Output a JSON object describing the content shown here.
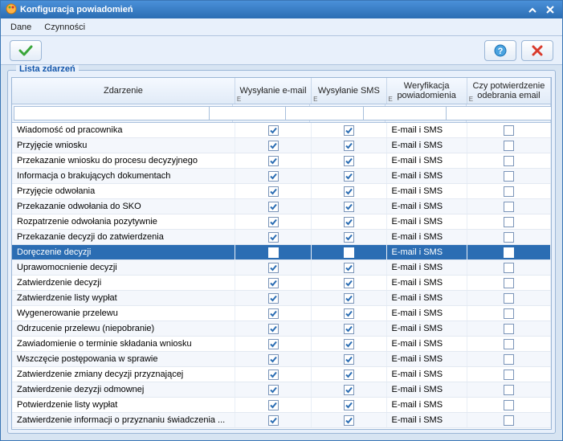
{
  "window": {
    "title": "Konfiguracja powiadomień"
  },
  "menu": {
    "dane": "Dane",
    "czynnosci": "Czynności"
  },
  "fieldset": {
    "legend": "Lista zdarzeń"
  },
  "columns": {
    "event": "Zdarzenie",
    "email": "Wysyłanie e-mail",
    "sms": "Wysyłanie SMS",
    "verif": "Weryfikacja powiadomienia",
    "confirm": "Czy potwierdzenie odebrania email",
    "sub": "E"
  },
  "rows": [
    {
      "event": "Wiadomość od pracownika",
      "email": true,
      "sms": true,
      "verif": "E-mail i SMS",
      "confirm": false
    },
    {
      "event": "Przyjęcie wniosku",
      "email": true,
      "sms": true,
      "verif": "E-mail i SMS",
      "confirm": false
    },
    {
      "event": "Przekazanie wniosku do procesu decyzyjnego",
      "email": true,
      "sms": true,
      "verif": "E-mail i SMS",
      "confirm": false
    },
    {
      "event": "Informacja o brakujących dokumentach",
      "email": true,
      "sms": true,
      "verif": "E-mail i SMS",
      "confirm": false
    },
    {
      "event": "Przyjęcie odwołania",
      "email": true,
      "sms": true,
      "verif": "E-mail i SMS",
      "confirm": false
    },
    {
      "event": "Przekazanie odwołania do SKO",
      "email": true,
      "sms": true,
      "verif": "E-mail i SMS",
      "confirm": false
    },
    {
      "event": "Rozpatrzenie odwołania pozytywnie",
      "email": true,
      "sms": true,
      "verif": "E-mail i SMS",
      "confirm": false
    },
    {
      "event": "Przekazanie decyzji do zatwierdzenia",
      "email": true,
      "sms": true,
      "verif": "E-mail i SMS",
      "confirm": false
    },
    {
      "event": "Doręczenie decyzji",
      "email": true,
      "sms": true,
      "verif": "E-mail i SMS",
      "confirm": false,
      "selected": true
    },
    {
      "event": "Uprawomocnienie decyzji",
      "email": true,
      "sms": true,
      "verif": "E-mail i SMS",
      "confirm": false
    },
    {
      "event": "Zatwierdzenie decyzji",
      "email": true,
      "sms": true,
      "verif": "E-mail i SMS",
      "confirm": false
    },
    {
      "event": "Zatwierdzenie listy wypłat",
      "email": true,
      "sms": true,
      "verif": "E-mail i SMS",
      "confirm": false
    },
    {
      "event": "Wygenerowanie przelewu",
      "email": true,
      "sms": true,
      "verif": "E-mail i SMS",
      "confirm": false
    },
    {
      "event": "Odrzucenie przelewu (niepobranie)",
      "email": true,
      "sms": true,
      "verif": "E-mail i SMS",
      "confirm": false
    },
    {
      "event": "Zawiadomienie o terminie składania wniosku",
      "email": true,
      "sms": true,
      "verif": "E-mail i SMS",
      "confirm": false
    },
    {
      "event": "Wszczęcie postępowania w sprawie",
      "email": true,
      "sms": true,
      "verif": "E-mail i SMS",
      "confirm": false
    },
    {
      "event": "Zatwierdzenie zmiany decyzji przyznającej",
      "email": true,
      "sms": true,
      "verif": "E-mail i SMS",
      "confirm": false
    },
    {
      "event": "Zatwierdzenie dezyzji odmownej",
      "email": true,
      "sms": true,
      "verif": "E-mail i SMS",
      "confirm": false
    },
    {
      "event": "Potwierdzenie listy wypłat",
      "email": true,
      "sms": true,
      "verif": "E-mail i SMS",
      "confirm": false
    },
    {
      "event": "Zatwierdzenie informacji o przyznaniu świadczenia ...",
      "email": true,
      "sms": true,
      "verif": "E-mail i SMS",
      "confirm": false
    }
  ]
}
